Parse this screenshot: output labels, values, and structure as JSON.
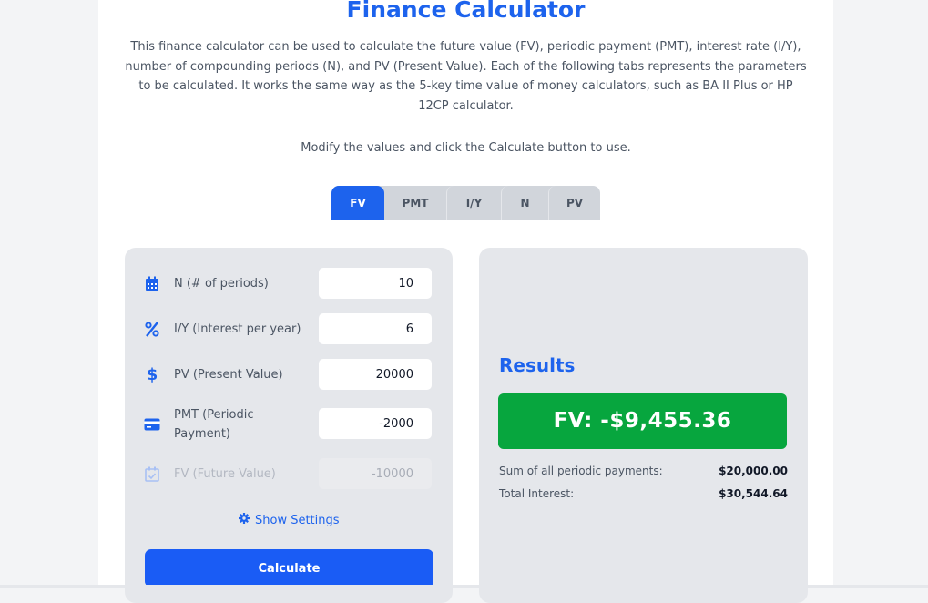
{
  "header": {
    "title": "Finance Calculator",
    "description": "This finance calculator can be used to calculate the future value (FV), periodic payment (PMT), interest rate (I/Y), number of compounding periods (N), and PV (Present Value). Each of the following tabs represents the parameters to be calculated. It works the same way as the 5-key time value of money calculators, such as BA II Plus or HP 12CP calculator.",
    "hint": "Modify the values and click the Calculate button to use."
  },
  "tabs": [
    {
      "label": "FV",
      "active": true
    },
    {
      "label": "PMT",
      "active": false
    },
    {
      "label": "I/Y",
      "active": false
    },
    {
      "label": "N",
      "active": false
    },
    {
      "label": "PV",
      "active": false
    }
  ],
  "inputs": {
    "n": {
      "label": "N (# of periods)",
      "value": "10",
      "icon": "calendar-icon"
    },
    "iy": {
      "label": "I/Y (Interest per year)",
      "value": "6",
      "icon": "percent-icon"
    },
    "pv": {
      "label": "PV (Present Value)",
      "value": "20000",
      "icon": "dollar-icon"
    },
    "pmt": {
      "label": "PMT (Periodic Payment)",
      "value": "-2000",
      "icon": "credit-card-icon"
    },
    "fv": {
      "label": "FV (Future Value)",
      "value": "-10000",
      "icon": "calendar-check-icon",
      "disabled": true
    }
  },
  "settings_link": {
    "label": "Show Settings",
    "icon": "gear-icon"
  },
  "calculate_button": {
    "label": "Calculate"
  },
  "results": {
    "title": "Results",
    "main": "FV: -$9,455.36",
    "lines": [
      {
        "label": "Sum of all periodic payments:",
        "value": "$20,000.00"
      },
      {
        "label": "Total Interest:",
        "value": "$30,544.64"
      }
    ]
  },
  "colors": {
    "accent": "#1d63ed",
    "result_green": "#07a63e",
    "card_bg": "#e5e7eb"
  }
}
